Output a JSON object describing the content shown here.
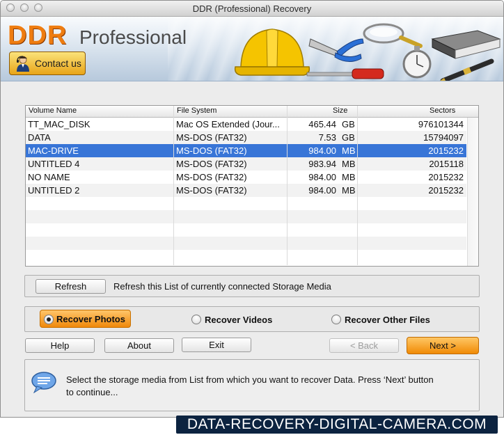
{
  "window": {
    "title": "DDR (Professional) Recovery"
  },
  "banner": {
    "brand": "DDR",
    "edition": "Professional",
    "contact_label": "Contact us"
  },
  "table": {
    "headers": [
      "Volume Name",
      "File System",
      "Size",
      "Sectors"
    ],
    "rows": [
      {
        "name": "TT_MAC_DISK",
        "fs": "Mac OS Extended (Jour...",
        "size": "465.44",
        "unit": "GB",
        "sectors": "976101344"
      },
      {
        "name": "DATA",
        "fs": "MS-DOS (FAT32)",
        "size": "7.53",
        "unit": "GB",
        "sectors": "15794097"
      },
      {
        "name": "MAC-DRIVE",
        "fs": "MS-DOS (FAT32)",
        "size": "984.00",
        "unit": "MB",
        "sectors": "2015232"
      },
      {
        "name": "UNTITLED 4",
        "fs": "MS-DOS (FAT32)",
        "size": "983.94",
        "unit": "MB",
        "sectors": "2015118"
      },
      {
        "name": "NO NAME",
        "fs": "MS-DOS (FAT32)",
        "size": "984.00",
        "unit": "MB",
        "sectors": "2015232"
      },
      {
        "name": "UNTITLED 2",
        "fs": "MS-DOS (FAT32)",
        "size": "984.00",
        "unit": "MB",
        "sectors": "2015232"
      }
    ],
    "selected_index": 2
  },
  "refresh": {
    "button_label": "Refresh",
    "description": "Refresh this List of currently connected Storage Media"
  },
  "recovery_options": [
    {
      "label": "Recover Photos",
      "selected": true
    },
    {
      "label": "Recover Videos",
      "selected": false
    },
    {
      "label": "Recover Other Files",
      "selected": false
    }
  ],
  "buttons": {
    "help": "Help",
    "about": "About",
    "exit": "Exit",
    "back": "< Back",
    "next": "Next >"
  },
  "info": {
    "message_line1": "Select the storage media from List from which you want to recover Data. Press ‘Next’ button",
    "message_line2": "to continue..."
  },
  "watermark": "DATA-RECOVERY-DIGITAL-CAMERA.COM",
  "colors": {
    "selection": "#3875d7",
    "accent_orange": "#f08a05",
    "brand_orange": "#ee7c10",
    "watermark_bg": "#0c2340"
  }
}
